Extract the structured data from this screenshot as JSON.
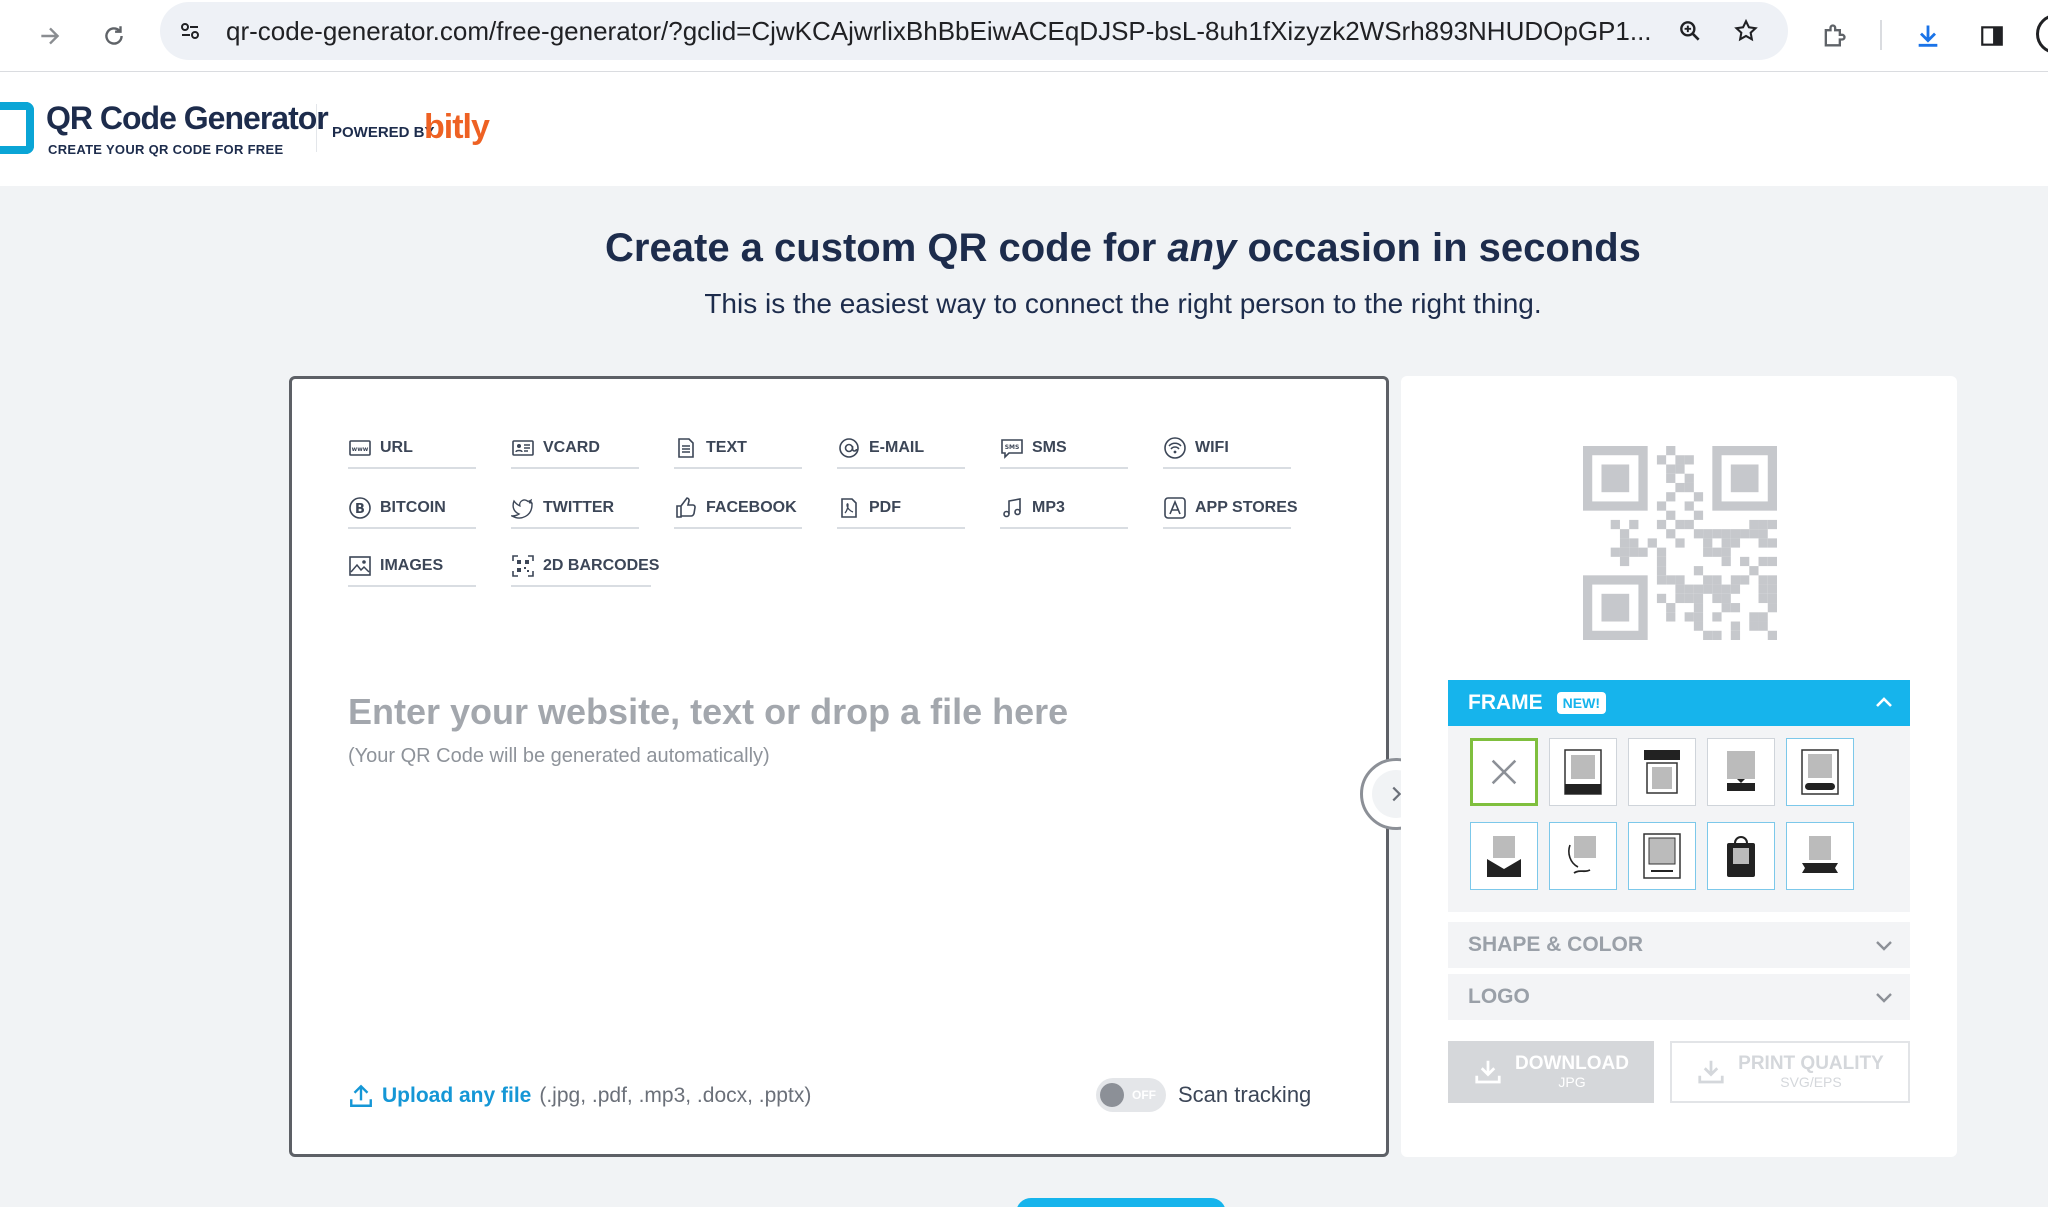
{
  "browser": {
    "url": "qr-code-generator.com/free-generator/?gclid=CjwKCAjwrlixBhBbEiwACEqDJSP-bsL-8uh1fXizyzk2WSrh893NHUDOpGP1..."
  },
  "header": {
    "logo_title": "QR Code Generator",
    "logo_sub": "CREATE YOUR QR CODE FOR FREE",
    "powered_by": "POWERED BY",
    "bitly": "bitly"
  },
  "hero": {
    "title_pre": "Create a custom QR code for ",
    "title_em": "any",
    "title_post": " occasion in seconds",
    "subtitle": "This is the easiest way to connect the right person to the right thing."
  },
  "tabs": [
    {
      "label": "URL",
      "icon": "www-icon"
    },
    {
      "label": "VCARD",
      "icon": "vcard-icon"
    },
    {
      "label": "TEXT",
      "icon": "document-icon"
    },
    {
      "label": "E-MAIL",
      "icon": "at-icon"
    },
    {
      "label": "SMS",
      "icon": "sms-icon"
    },
    {
      "label": "WIFI",
      "icon": "wifi-icon"
    },
    {
      "label": "BITCOIN",
      "icon": "bitcoin-icon"
    },
    {
      "label": "TWITTER",
      "icon": "twitter-icon"
    },
    {
      "label": "FACEBOOK",
      "icon": "thumbs-up-icon"
    },
    {
      "label": "PDF",
      "icon": "pdf-icon"
    },
    {
      "label": "MP3",
      "icon": "music-note-icon"
    },
    {
      "label": "APP STORES",
      "icon": "app-store-icon"
    },
    {
      "label": "IMAGES",
      "icon": "image-icon"
    },
    {
      "label": "2D BARCODES",
      "icon": "barcode-icon"
    }
  ],
  "input": {
    "placeholder": "Enter your website, text or drop a file here",
    "hint": "(Your QR Code will be generated automatically)"
  },
  "upload": {
    "link": "Upload any file",
    "types": " (.jpg, .pdf, .mp3, .docx, .pptx)"
  },
  "scan_tracking": {
    "state": "OFF",
    "label": "Scan tracking"
  },
  "panel": {
    "frame_title": "FRAME",
    "frame_badge": "NEW!",
    "shape_color": "SHAPE & COLOR",
    "logo": "LOGO",
    "download_main": "DOWNLOAD",
    "download_sub": "JPG",
    "print_main": "PRINT QUALITY",
    "print_sub": "SVG/EPS"
  },
  "colors": {
    "accent": "#16b4ec",
    "brand_text": "#1d2c4c",
    "bitly": "#ee6123",
    "selected_frame": "#7fbf3e"
  }
}
